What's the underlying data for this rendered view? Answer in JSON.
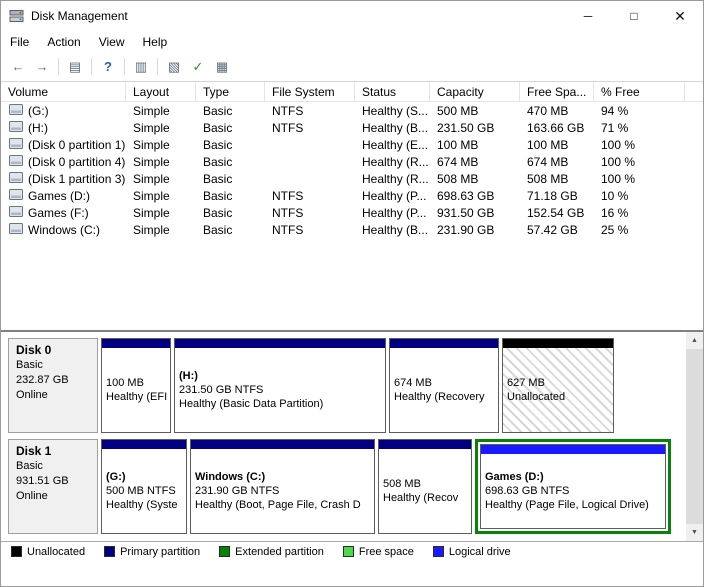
{
  "window": {
    "title": "Disk Management",
    "minimize": "─",
    "maximize": "□",
    "close": "✕"
  },
  "menu": {
    "items": [
      "File",
      "Action",
      "View",
      "Help"
    ]
  },
  "toolbar": {
    "icons": [
      {
        "name": "back",
        "glyph": "←"
      },
      {
        "name": "forward",
        "glyph": "→"
      },
      {
        "name": "show-console-tree",
        "glyph": "▤"
      },
      {
        "name": "help",
        "glyph": "?"
      },
      {
        "name": "disk-list-view",
        "glyph": "▥"
      },
      {
        "name": "properties",
        "glyph": "▧"
      },
      {
        "name": "action-check",
        "glyph": "✓"
      },
      {
        "name": "graphical-view",
        "glyph": "▦"
      }
    ]
  },
  "table": {
    "columns": [
      "Volume",
      "Layout",
      "Type",
      "File System",
      "Status",
      "Capacity",
      "Free Spa...",
      "% Free"
    ],
    "rows": [
      {
        "volume": "(G:)",
        "layout": "Simple",
        "type": "Basic",
        "fs": "NTFS",
        "status": "Healthy (S...",
        "capacity": "500 MB",
        "free": "470 MB",
        "pct": "94 %"
      },
      {
        "volume": "(H:)",
        "layout": "Simple",
        "type": "Basic",
        "fs": "NTFS",
        "status": "Healthy (B...",
        "capacity": "231.50 GB",
        "free": "163.66 GB",
        "pct": "71 %"
      },
      {
        "volume": "(Disk 0 partition 1)",
        "layout": "Simple",
        "type": "Basic",
        "fs": "",
        "status": "Healthy (E...",
        "capacity": "100 MB",
        "free": "100 MB",
        "pct": "100 %"
      },
      {
        "volume": "(Disk 0 partition 4)",
        "layout": "Simple",
        "type": "Basic",
        "fs": "",
        "status": "Healthy (R...",
        "capacity": "674 MB",
        "free": "674 MB",
        "pct": "100 %"
      },
      {
        "volume": "(Disk 1 partition 3)",
        "layout": "Simple",
        "type": "Basic",
        "fs": "",
        "status": "Healthy (R...",
        "capacity": "508 MB",
        "free": "508 MB",
        "pct": "100 %"
      },
      {
        "volume": "Games (D:)",
        "layout": "Simple",
        "type": "Basic",
        "fs": "NTFS",
        "status": "Healthy (P...",
        "capacity": "698.63 GB",
        "free": "71.18 GB",
        "pct": "10 %"
      },
      {
        "volume": "Games (F:)",
        "layout": "Simple",
        "type": "Basic",
        "fs": "NTFS",
        "status": "Healthy (P...",
        "capacity": "931.50 GB",
        "free": "152.54 GB",
        "pct": "16 %"
      },
      {
        "volume": "Windows (C:)",
        "layout": "Simple",
        "type": "Basic",
        "fs": "NTFS",
        "status": "Healthy (B...",
        "capacity": "231.90 GB",
        "free": "57.42 GB",
        "pct": "25 %"
      }
    ]
  },
  "disks": [
    {
      "name": "Disk 0",
      "type": "Basic",
      "size": "232.87 GB",
      "status": "Online",
      "partitions": [
        {
          "lines": [
            "100 MB",
            "Healthy (EFI"
          ]
        },
        {
          "lines": [
            "(H:)",
            "231.50 GB NTFS",
            "Healthy (Basic Data Partition)"
          ]
        },
        {
          "lines": [
            "674 MB",
            "Healthy (Recovery"
          ]
        },
        {
          "lines": [
            "627 MB",
            "Unallocated"
          ]
        }
      ]
    },
    {
      "name": "Disk 1",
      "type": "Basic",
      "size": "931.51 GB",
      "status": "Online",
      "partitions": [
        {
          "lines": [
            "(G:)",
            "500 MB NTFS",
            "Healthy (Syste"
          ]
        },
        {
          "lines": [
            "Windows (C:)",
            "231.90 GB NTFS",
            "Healthy (Boot, Page File, Crash D"
          ]
        },
        {
          "lines": [
            "508 MB",
            "Healthy (Recov"
          ]
        },
        {
          "lines": [
            "Games (D:)",
            "698.63 GB NTFS",
            "Healthy (Page File, Logical Drive)"
          ]
        }
      ]
    }
  ],
  "legend": {
    "items": [
      {
        "label": "Unallocated",
        "color": "#000000"
      },
      {
        "label": "Primary partition",
        "color": "#000080"
      },
      {
        "label": "Extended partition",
        "color": "#078407"
      },
      {
        "label": "Free space",
        "color": "#4cd94c"
      },
      {
        "label": "Logical drive",
        "color": "#1a1aff"
      }
    ]
  },
  "scrollbar": {
    "up": "▲",
    "down": "▼"
  }
}
